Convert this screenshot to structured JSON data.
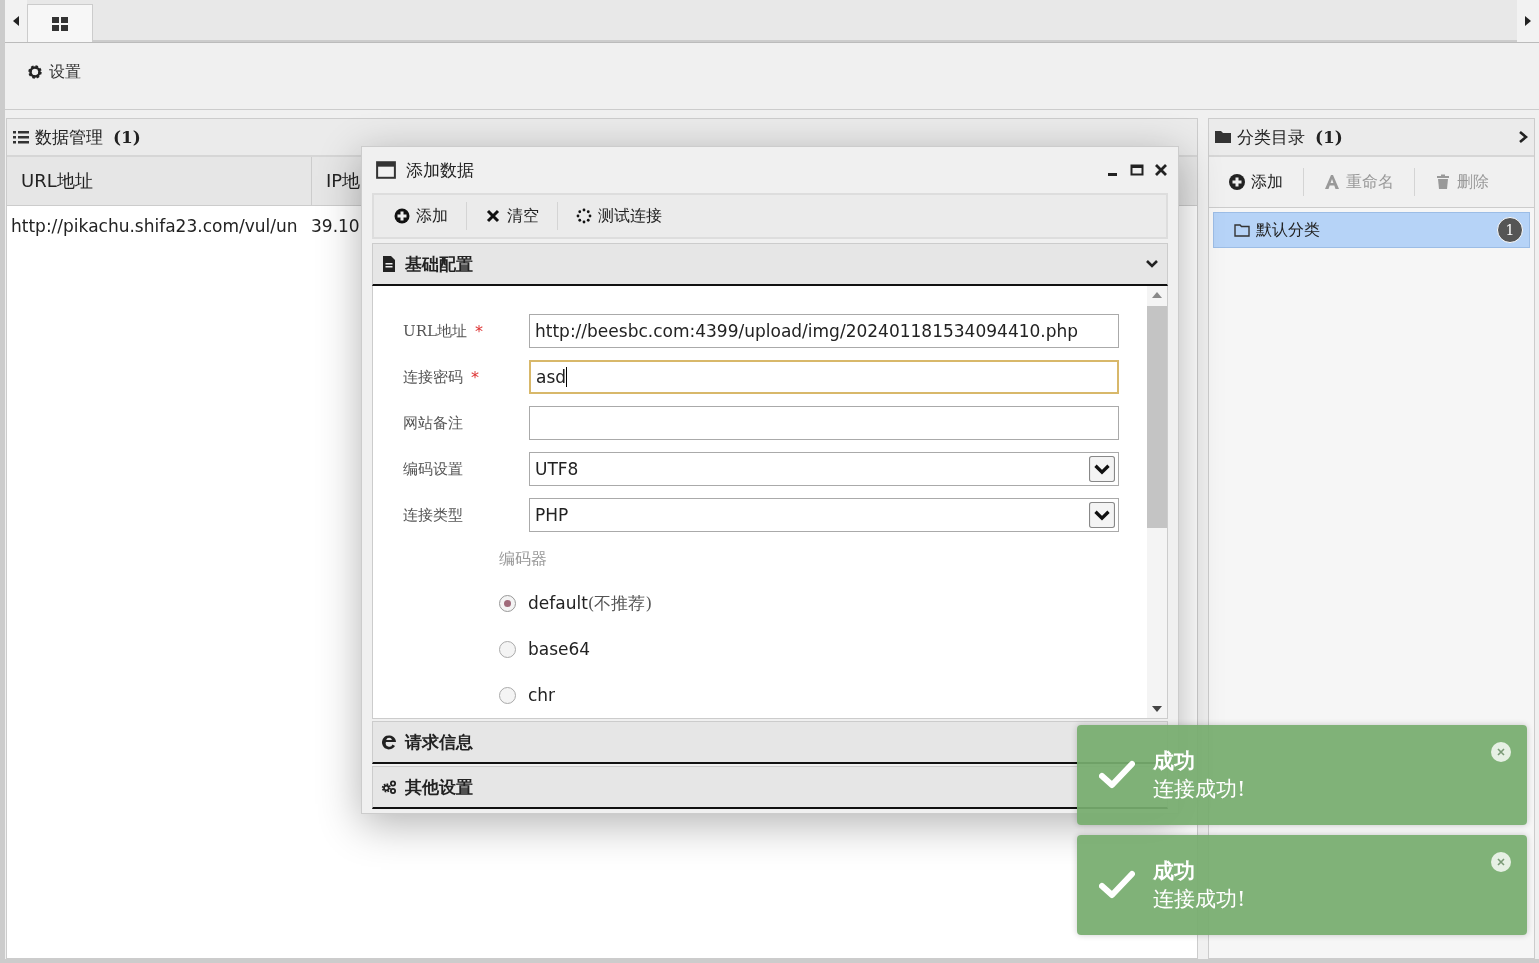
{
  "toolbar": {
    "settings": "设置"
  },
  "data_panel": {
    "title": "数据管理",
    "count": "(1)",
    "columns": [
      "URL地址",
      "IP地"
    ],
    "rows": [
      [
        "http://pikachu.shifa23.com/vul/un",
        "39.10"
      ]
    ]
  },
  "category_panel": {
    "title": "分类目录",
    "count": "(1)",
    "actions": [
      {
        "label": "添加",
        "disabled": false
      },
      {
        "label": "重命名",
        "disabled": true
      },
      {
        "label": "删除",
        "disabled": true
      }
    ],
    "items": [
      {
        "label": "默认分类",
        "badge": "1",
        "selected": true
      }
    ]
  },
  "dialog": {
    "title": "添加数据",
    "actions": [
      "添加",
      "清空",
      "测试连接"
    ],
    "sections": [
      {
        "title": "基础配置",
        "expanded": true
      },
      {
        "title": "请求信息",
        "expanded": false
      },
      {
        "title": "其他设置",
        "expanded": false
      }
    ],
    "fields": [
      {
        "label": "URL地址",
        "required_mark": "*",
        "kind": "text",
        "value": "http://beesbc.com:4399/upload/img/202401181534094410.php",
        "focused": false
      },
      {
        "label": "连接密码",
        "required_mark": "*",
        "kind": "text",
        "value": "asd",
        "focused": true
      },
      {
        "label": "网站备注",
        "kind": "text",
        "focused": false
      },
      {
        "label": "编码设置",
        "kind": "select",
        "value": "UTF8",
        "focused": false
      },
      {
        "label": "连接类型",
        "kind": "select",
        "value": "PHP",
        "focused": false
      }
    ],
    "encoder": {
      "label": "编码器",
      "options": [
        {
          "label": "default",
          "note": "(不推荐)",
          "selected": true
        },
        {
          "label": "base64",
          "selected": false
        },
        {
          "label": "chr",
          "selected": false
        }
      ]
    }
  },
  "toasts": [
    {
      "title": "成功",
      "message": "连接成功!"
    },
    {
      "title": "成功",
      "message": "连接成功!"
    }
  ]
}
